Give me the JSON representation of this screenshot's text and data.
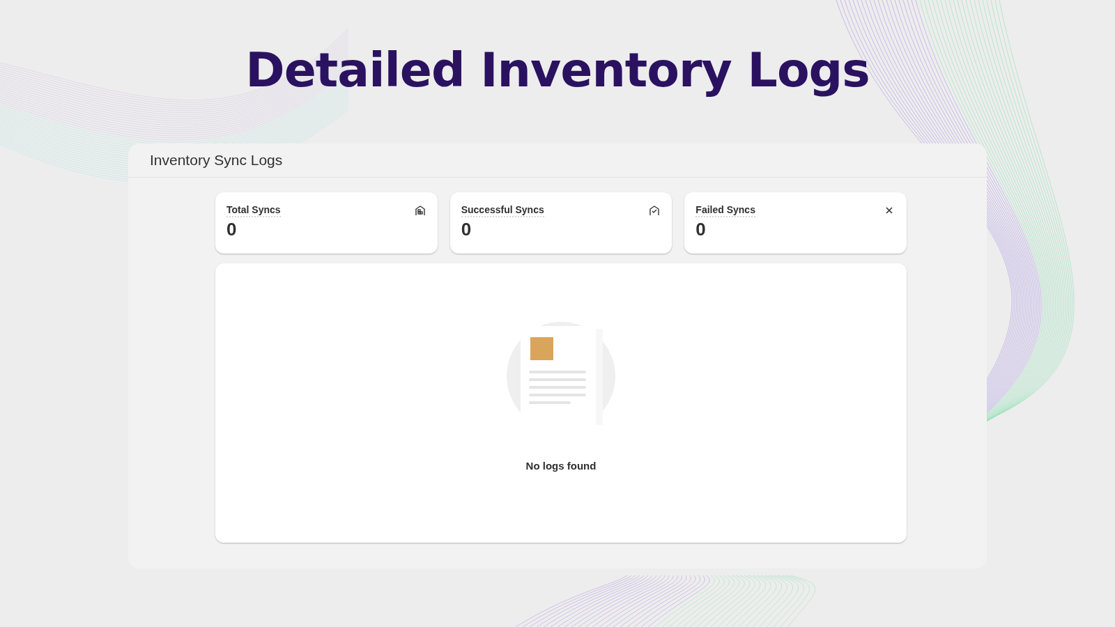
{
  "headline": "Detailed Inventory Logs",
  "panel": {
    "title": "Inventory Sync Logs"
  },
  "stats": [
    {
      "kind": "total",
      "label": "Total Syncs",
      "value": "0"
    },
    {
      "kind": "success",
      "label": "Successful Syncs",
      "value": "0"
    },
    {
      "kind": "failed",
      "label": "Failed Syncs",
      "value": "0"
    }
  ],
  "empty_state": {
    "message": "No logs found"
  }
}
